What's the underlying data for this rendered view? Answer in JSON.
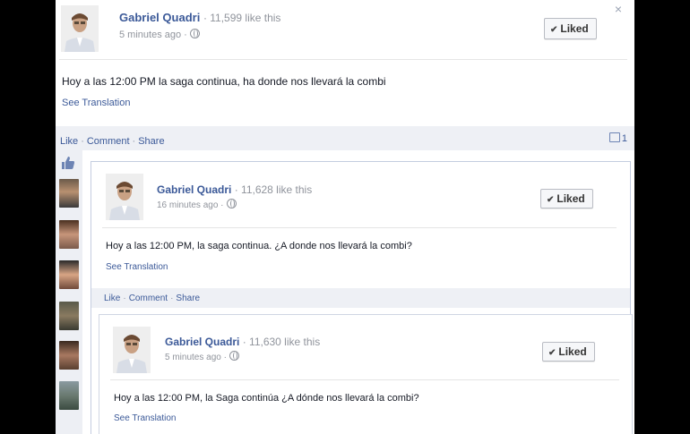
{
  "close_label": "×",
  "posts": [
    {
      "author": "Gabriel Quadri",
      "likes_text": "· 11,599 like this",
      "time": "5 minutes ago",
      "time_sep": "·",
      "liked_label": "Liked",
      "text": "Hoy a las 12:00 PM la saga continua, ha donde nos llevará la combi",
      "see_translation": "See Translation",
      "actions": {
        "like": "Like",
        "comment": "Comment",
        "share": "Share"
      },
      "comment_count": "1"
    },
    {
      "author": "Gabriel Quadri",
      "likes_text": "· 11,628 like this",
      "time": "16 minutes ago",
      "time_sep": "·",
      "liked_label": "Liked",
      "text": "Hoy a las 12:00 PM, la saga continua. ¿A donde nos llevará la combi?",
      "see_translation": "See Translation",
      "actions": {
        "like": "Like",
        "comment": "Comment",
        "share": "Share"
      }
    },
    {
      "author": "Gabriel Quadri",
      "likes_text": "· 11,630 like this",
      "time": "5 minutes ago",
      "time_sep": "·",
      "liked_label": "Liked",
      "text": "Hoy a las 12:00 PM, la Saga continúa ¿A dónde nos llevará la combi?",
      "see_translation": "See Translation"
    }
  ],
  "colors": {
    "link": "#3b5998",
    "meta": "#90949c",
    "bar": "#eef0f5"
  }
}
